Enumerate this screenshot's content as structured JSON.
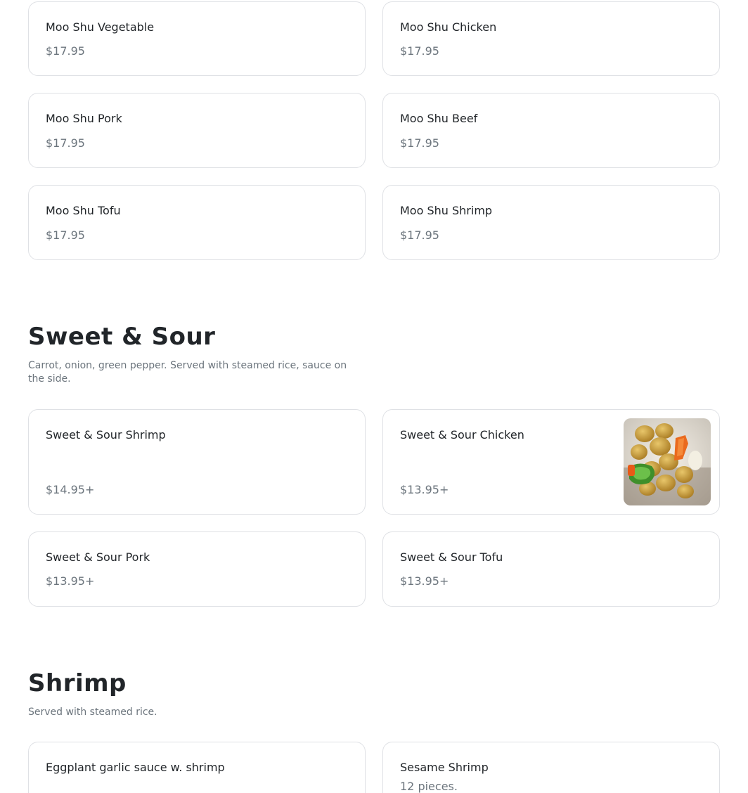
{
  "moo_shu": {
    "items": [
      {
        "name": "Moo Shu Vegetable",
        "price": "$17.95"
      },
      {
        "name": "Moo Shu Chicken",
        "price": "$17.95"
      },
      {
        "name": "Moo Shu Pork",
        "price": "$17.95"
      },
      {
        "name": "Moo Shu Beef",
        "price": "$17.95"
      },
      {
        "name": "Moo Shu Tofu",
        "price": "$17.95"
      },
      {
        "name": "Moo Shu Shrimp",
        "price": "$17.95"
      }
    ]
  },
  "sweet_sour": {
    "title": "Sweet & Sour",
    "description": "Carrot, onion, green pepper. Served with steamed rice, sauce on the side.",
    "items": [
      {
        "name": "Sweet & Sour Shrimp",
        "price": "$14.95+"
      },
      {
        "name": "Sweet & Sour Chicken",
        "price": "$13.95+",
        "photo": "sweet-and-sour-chicken-photo"
      },
      {
        "name": "Sweet & Sour Pork",
        "price": "$13.95+"
      },
      {
        "name": "Sweet & Sour Tofu",
        "price": "$13.95+"
      }
    ]
  },
  "shrimp": {
    "title": "Shrimp",
    "description": "Served with steamed rice.",
    "items": [
      {
        "name": "Eggplant garlic sauce w. shrimp"
      },
      {
        "name": "Sesame Shrimp",
        "description": "12 pieces."
      }
    ]
  }
}
